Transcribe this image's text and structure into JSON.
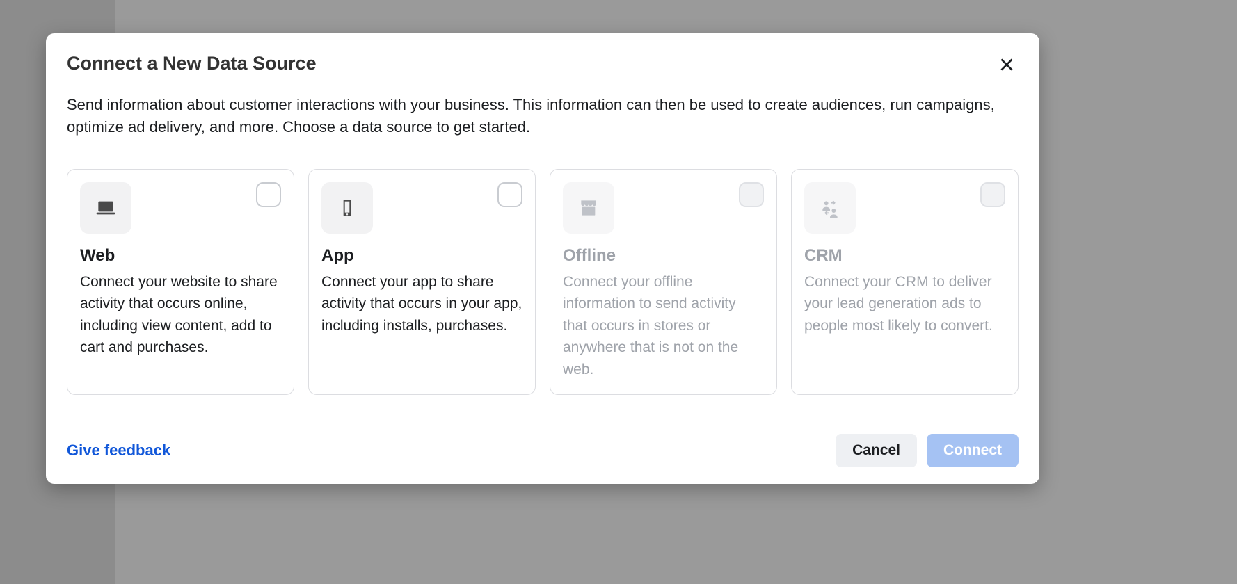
{
  "modal": {
    "title": "Connect a New Data Source",
    "description": "Send information about customer interactions with your business. This information can then be used to create audiences, run campaigns, optimize ad delivery, and more. Choose a data source to get started."
  },
  "cards": [
    {
      "id": "web",
      "icon": "laptop-icon",
      "title": "Web",
      "text": "Connect your website to share activity that occurs online, including view content, add to cart and purchases.",
      "enabled": true
    },
    {
      "id": "app",
      "icon": "mobile-icon",
      "title": "App",
      "text": "Connect your app to share activity that occurs in your app, including installs, purchases.",
      "enabled": true
    },
    {
      "id": "offline",
      "icon": "store-icon",
      "title": "Offline",
      "text": "Connect your offline information to send activity that occurs in stores or anywhere that is not on the web.",
      "enabled": false
    },
    {
      "id": "crm",
      "icon": "crm-icon",
      "title": "CRM",
      "text": "Connect your CRM to deliver your lead generation ads to people most likely to convert.",
      "enabled": false
    }
  ],
  "footer": {
    "feedback": "Give feedback",
    "cancel": "Cancel",
    "connect": "Connect",
    "connect_enabled": false
  }
}
